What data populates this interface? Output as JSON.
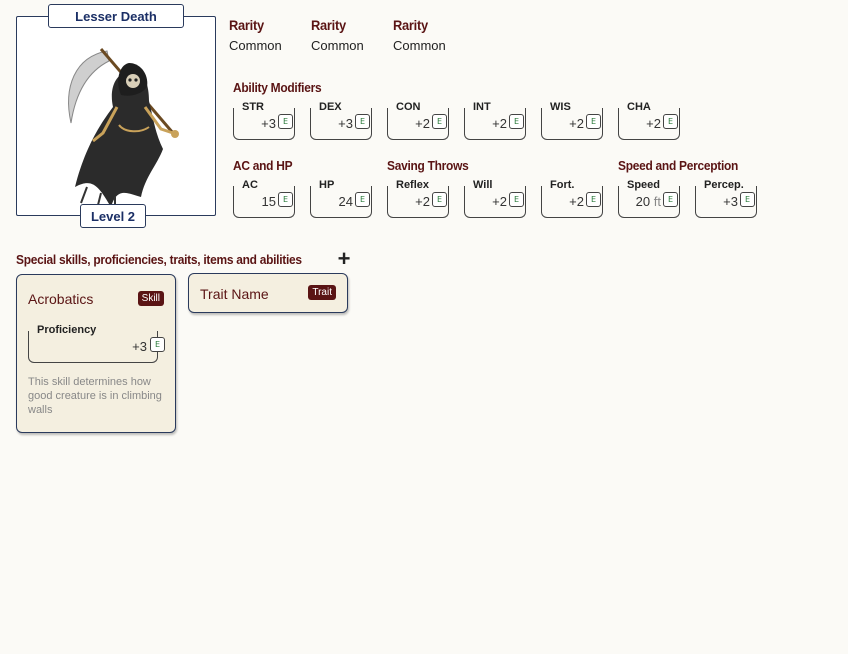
{
  "creature": {
    "name": "Lesser Death",
    "level": "Level 2"
  },
  "rarity": [
    {
      "label": "Rarity",
      "value": "Common"
    },
    {
      "label": "Rarity",
      "value": "Common"
    },
    {
      "label": "Rarity",
      "value": "Common"
    }
  ],
  "ability": {
    "heading": "Ability Modifiers",
    "stats": [
      {
        "label": "STR",
        "value": "+3"
      },
      {
        "label": "DEX",
        "value": "+3"
      },
      {
        "label": "CON",
        "value": "+2"
      },
      {
        "label": "INT",
        "value": "+2"
      },
      {
        "label": "WIS",
        "value": "+2"
      },
      {
        "label": "CHA",
        "value": "+2"
      }
    ]
  },
  "ac_hp": {
    "heading": "AC and HP",
    "stats": [
      {
        "label": "AC",
        "value": "15"
      },
      {
        "label": "HP",
        "value": "24"
      }
    ]
  },
  "saves": {
    "heading": "Saving Throws",
    "stats": [
      {
        "label": "Reflex",
        "value": "+2"
      },
      {
        "label": "Will",
        "value": "+2"
      },
      {
        "label": "Fort.",
        "value": "+2"
      }
    ]
  },
  "speed_perc": {
    "heading": "Speed and Perception",
    "speed": {
      "label": "Speed",
      "value": "20",
      "unit": "ft"
    },
    "perception": {
      "label": "Percep.",
      "value": "+3"
    }
  },
  "edit_label": "E",
  "special": {
    "heading": "Special skills, proficiencies, traits, items and abilities",
    "add_icon": "plus-icon",
    "cards": [
      {
        "title": "Acrobatics",
        "badge": "Skill",
        "prof_label": "Proficiency",
        "prof_value": "+3",
        "description": "This skill determines how good creature is in climbing walls"
      },
      {
        "title": "Trait Name",
        "badge": "Trait"
      }
    ]
  },
  "colors": {
    "accent": "#5a1414",
    "navy": "#1b2f66",
    "card": "#f4efe0",
    "edit": "#2a7a3a"
  }
}
